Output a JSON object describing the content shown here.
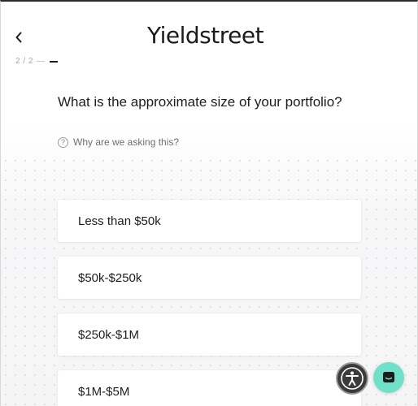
{
  "header": {
    "logo_text": "Yieldstreet",
    "back_icon": "chevron-left-icon"
  },
  "progress": {
    "label": "2 / 2"
  },
  "question": {
    "title": "What is the approximate size of your portfolio?",
    "help_text": "Why are we asking this?",
    "help_icon_glyph": "?"
  },
  "options": [
    {
      "label": "Less than $50k"
    },
    {
      "label": "$50k-$250k"
    },
    {
      "label": "$250k-$1M"
    },
    {
      "label": "$1M-$5M"
    }
  ],
  "floating": {
    "accessibility_icon": "accessibility-icon",
    "chat_icon": "chat-icon",
    "chat_color": "#70e0c8"
  }
}
